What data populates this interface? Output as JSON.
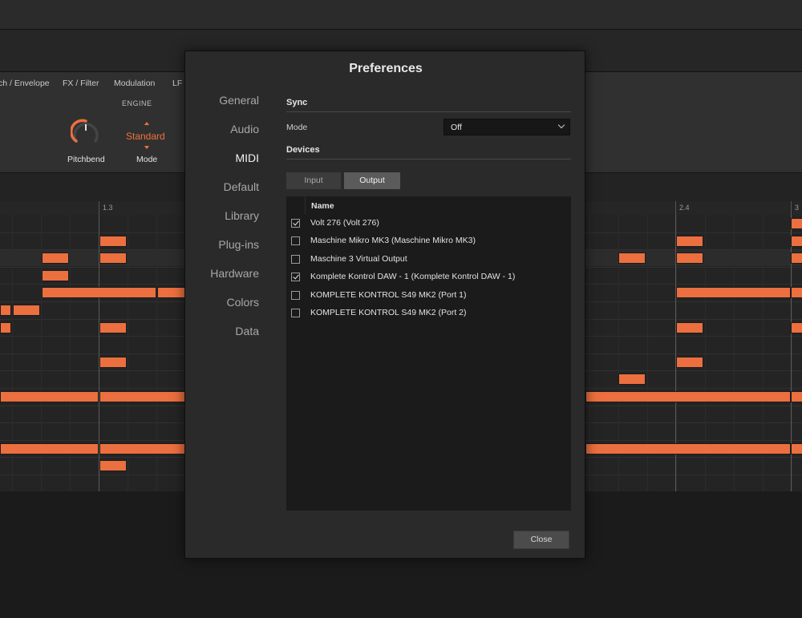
{
  "background": {
    "panel_tabs": [
      "ch / Envelope",
      "FX / Filter",
      "Modulation",
      "LF"
    ],
    "engine_label": "ENGINE",
    "pitchbend_label": "Pitchbend",
    "mode_value": "Standard",
    "mode_label": "Mode",
    "ruler_labels": [
      "1.3",
      "2.4",
      "3"
    ],
    "accent_color": "#eb6f3f"
  },
  "dialog": {
    "title": "Preferences",
    "nav": [
      "General",
      "Audio",
      "MIDI",
      "Default",
      "Library",
      "Plug-ins",
      "Hardware",
      "Colors",
      "Data"
    ],
    "active_nav": "MIDI",
    "sync": {
      "section_label": "Sync",
      "mode_label": "Mode",
      "mode_value": "Off"
    },
    "devices": {
      "section_label": "Devices",
      "tabs": [
        "Input",
        "Output"
      ],
      "active_tab": "Output",
      "column_header": "Name",
      "items": [
        {
          "name": "Volt 276 (Volt 276)",
          "checked": true
        },
        {
          "name": "Maschine Mikro MK3 (Maschine Mikro MK3)",
          "checked": false
        },
        {
          "name": "Maschine 3 Virtual Output",
          "checked": false
        },
        {
          "name": "Komplete Kontrol DAW - 1 (Komplete Kontrol DAW - 1)",
          "checked": true
        },
        {
          "name": "KOMPLETE KONTROL S49 MK2 (Port 1)",
          "checked": false
        },
        {
          "name": "KOMPLETE KONTROL S49 MK2 (Port 2)",
          "checked": false
        }
      ]
    },
    "close_label": "Close"
  }
}
